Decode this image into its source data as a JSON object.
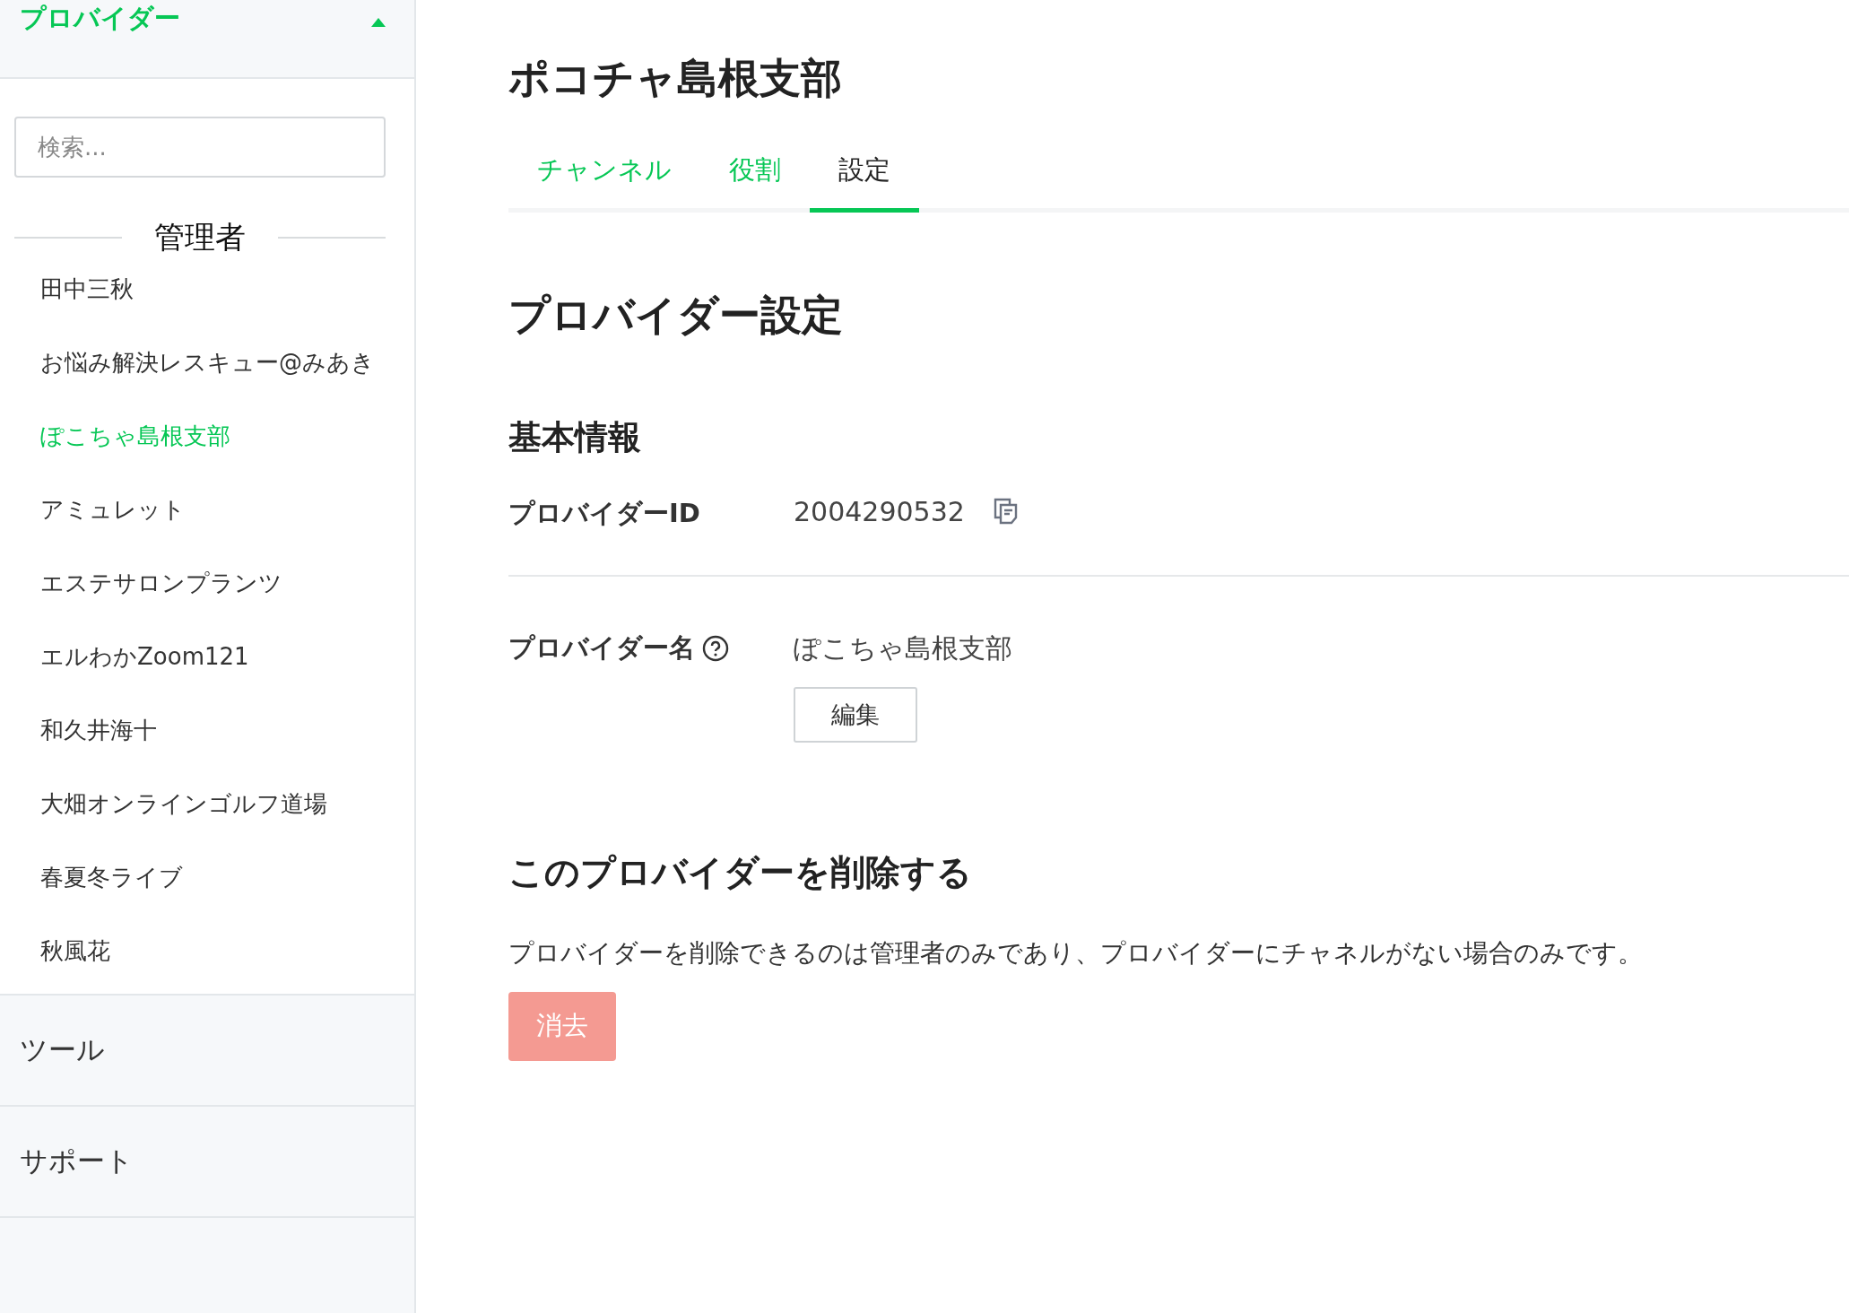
{
  "sidebar": {
    "header": {
      "title": "プロバイダー",
      "expanded": true
    },
    "search": {
      "placeholder": "検索..."
    },
    "group_title": "管理者",
    "items": [
      {
        "label": "田中三秋",
        "selected": false
      },
      {
        "label": "お悩み解決レスキュー@みあき",
        "selected": false
      },
      {
        "label": "ぽこちゃ島根支部",
        "selected": true
      },
      {
        "label": "アミュレット",
        "selected": false
      },
      {
        "label": "エステサロンプランツ",
        "selected": false
      },
      {
        "label": "エルわかZoom121",
        "selected": false
      },
      {
        "label": "和久井海十",
        "selected": false
      },
      {
        "label": "大畑オンラインゴルフ道場",
        "selected": false
      },
      {
        "label": "春夏冬ライブ",
        "selected": false
      },
      {
        "label": "秋風花",
        "selected": false
      }
    ],
    "sections": [
      "ツール",
      "サポート"
    ]
  },
  "main": {
    "title": "ポコチャ島根支部",
    "tabs": [
      {
        "label": "チャンネル",
        "selected": false
      },
      {
        "label": "役割",
        "selected": false
      },
      {
        "label": "設定",
        "selected": true
      }
    ],
    "heading": "プロバイダー設定",
    "subheading": "基本情報",
    "id_row": {
      "label": "プロバイダーID",
      "value": "2004290532"
    },
    "name_row": {
      "label": "プロバイダー名",
      "value": "ぽこちゃ島根支部",
      "button": "編集"
    },
    "delete": {
      "heading": "このプロバイダーを削除する",
      "text": "プロバイダーを削除できるのは管理者のみであり、プロバイダーにチャネルがない場合のみです。",
      "button": "消去",
      "disabled": true
    }
  }
}
